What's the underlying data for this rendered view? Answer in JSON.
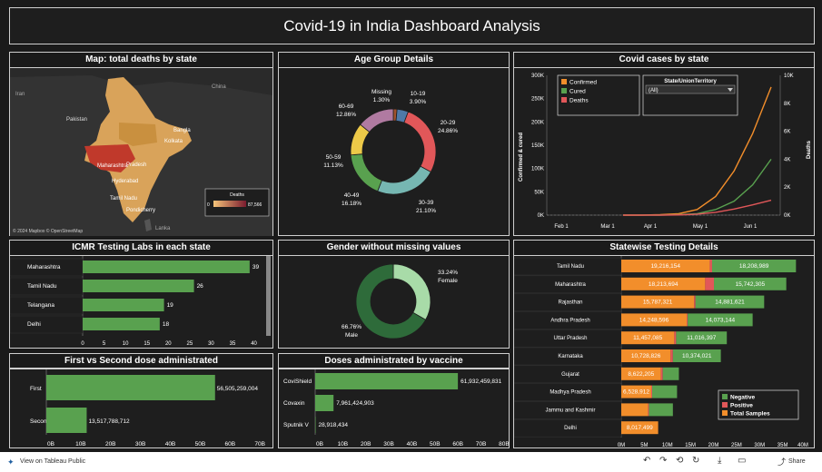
{
  "dashboard_title": "Covid-19 in India Dashboard Analysis",
  "map": {
    "title": "Map: total deaths by state",
    "labels": [
      "Iran",
      "Pakistan",
      "Maharashtra",
      "Kolkata",
      "Bangla",
      "Hyderabad",
      "Pradesh",
      "Tamil Nadu",
      "Pondicherry",
      "China",
      "Lanka"
    ],
    "legend_title": "Deaths",
    "legend_min": "0",
    "legend_max": "87,566",
    "attribution": "© 2024 Mapbox © OpenStreetMap",
    "colors": {
      "low": "#d9a35a",
      "high": "#c0392b"
    }
  },
  "age": {
    "title": "Age Group Details",
    "chart_data": {
      "type": "pie",
      "categories": [
        "Missing",
        "10-19",
        "20-29",
        "30-39",
        "40-49",
        "50-59",
        "60-69"
      ],
      "values": [
        1.3,
        3.9,
        24.86,
        21.1,
        16.18,
        11.13,
        12.86
      ],
      "labels": [
        "1.30%",
        "3.90%",
        "24.86%",
        "21.10%",
        "16.18%",
        "11.13%",
        "12.86%"
      ],
      "colors": [
        "#a0522d",
        "#4e79a7",
        "#e15759",
        "#76b7b2",
        "#59a14f",
        "#edc948",
        "#b07aa1"
      ]
    }
  },
  "cases": {
    "title": "Covid cases by state",
    "legend": [
      "Confirmed",
      "Cured",
      "Deaths"
    ],
    "filter_title": "State/UnionTerritory",
    "filter_value": "(All)",
    "chart_data": {
      "type": "line",
      "x": [
        "Feb 1",
        "Mar 1",
        "Apr 1",
        "May 1",
        "Jun 1"
      ],
      "ylabel": "Confirmed & cured",
      "y2label": "Deaths",
      "y_ticks": [
        "0K",
        "50K",
        "100K",
        "150K",
        "200K",
        "250K",
        "300K"
      ],
      "y2_ticks": [
        "0K",
        "2K",
        "4K",
        "6K",
        "8K",
        "10K"
      ],
      "series": [
        {
          "name": "Confirmed",
          "color": "#f28e2b",
          "values": [
            0,
            0,
            1,
            3,
            12,
            40,
            95,
            175,
            275
          ]
        },
        {
          "name": "Cured",
          "color": "#59a14f",
          "values": [
            0,
            0,
            0,
            1,
            3,
            12,
            30,
            65,
            120
          ]
        },
        {
          "name": "Deaths",
          "color": "#e15759",
          "values": [
            0,
            0,
            0,
            0.5,
            2,
            6,
            13,
            22,
            32
          ]
        }
      ]
    }
  },
  "icmr": {
    "title": "ICMR Testing Labs in each state",
    "chart_data": {
      "type": "bar",
      "categories": [
        "Maharashtra",
        "Tamil Nadu",
        "Telangana",
        "Delhi"
      ],
      "values": [
        39,
        26,
        19,
        18
      ],
      "ticks": [
        "0",
        "5",
        "10",
        "15",
        "20",
        "25",
        "30",
        "35",
        "40"
      ]
    }
  },
  "gender": {
    "title": "Gender without missing values",
    "chart_data": {
      "type": "pie",
      "categories": [
        "Female",
        "Male"
      ],
      "values": [
        33.24,
        66.76
      ],
      "labels": [
        "33.24%",
        "66.76%"
      ],
      "colors": [
        "#a8dba8",
        "#2e6b3a"
      ]
    }
  },
  "statewise": {
    "title": "Statewise Testing Details",
    "legend": [
      "Negative",
      "Positive",
      "Total Samples"
    ],
    "colors": {
      "negative": "#59a14f",
      "positive": "#e15759",
      "total": "#f28e2b"
    },
    "chart_data": {
      "type": "bar",
      "categories": [
        "Tamil Nadu",
        "Maharashtra",
        "Rajasthan",
        "Andhra Pradesh",
        "Uttar Pradesh",
        "Karnataka",
        "Gujarat",
        "Madhya Pradesh",
        "Jammu and Kashmir",
        "Delhi"
      ],
      "total_labels": [
        "19,216,154",
        "18,213,694",
        "15,787,321",
        "14,248,596",
        "11,457,085",
        "10,728,826",
        "8,622,205",
        "6,528,912",
        "",
        ""
      ],
      "negative_labels": [
        "18,208,989",
        "15,742,305",
        "14,881,621",
        "14,073,144",
        "11,016,397",
        "10,374,021",
        "",
        "",
        "",
        ""
      ],
      "extra_labels": [
        "",
        "",
        "",
        "",
        "",
        "",
        "",
        "",
        "",
        "8,017,499"
      ],
      "total_samples": [
        19.2,
        18.2,
        15.8,
        14.2,
        11.5,
        10.7,
        8.6,
        6.5,
        5.8,
        8.0
      ],
      "positive": [
        0.5,
        1.9,
        0.3,
        0.2,
        0.4,
        0.5,
        0.4,
        0.2,
        0.2,
        0.0
      ],
      "negative": [
        18.2,
        15.7,
        14.9,
        14.1,
        11.0,
        10.4,
        3.5,
        5.4,
        5.2,
        0.0
      ],
      "ticks": [
        "0M",
        "5M",
        "10M",
        "15M",
        "20M",
        "25M",
        "30M",
        "35M",
        "40M"
      ]
    }
  },
  "doses": {
    "title": "First vs Second dose administrated",
    "chart_data": {
      "type": "bar",
      "categories": [
        "First",
        "Second"
      ],
      "values": [
        56505259004,
        13517788712
      ],
      "labels": [
        "56,505,259,004",
        "13,517,788,712"
      ],
      "ticks": [
        "0B",
        "10B",
        "20B",
        "30B",
        "40B",
        "50B",
        "60B",
        "70B"
      ]
    }
  },
  "vaccine": {
    "title": "Doses administrated by vaccine",
    "chart_data": {
      "type": "bar",
      "categories": [
        "CoviShield",
        "Covaxin",
        "Sputnik V"
      ],
      "values": [
        61932459831,
        7961424903,
        28918434
      ],
      "labels": [
        "61,932,459,831",
        "7,961,424,903",
        "28,918,434"
      ],
      "ticks": [
        "0B",
        "10B",
        "20B",
        "30B",
        "40B",
        "50B",
        "60B",
        "70B",
        "80B"
      ]
    }
  },
  "footer": {
    "link": "View on Tableau Public",
    "share": "Share"
  }
}
